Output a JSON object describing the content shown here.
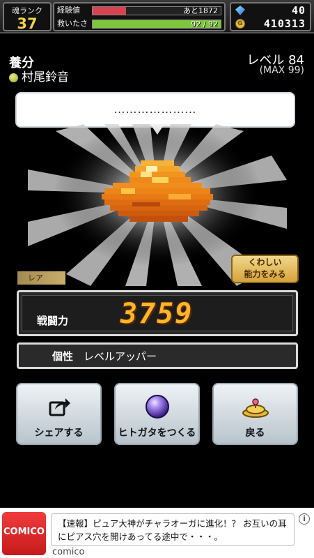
{
  "header": {
    "rank_label": "魂ランク",
    "rank_value": "37",
    "exp_label": "経験値",
    "exp_text": "あと1872",
    "exp_fill": 0.26,
    "saved_label": "救いたさ",
    "saved_text": "92 / 92",
    "saved_fill": 1.0,
    "gems": "40",
    "coins": "410313",
    "coin_icon_text": "G"
  },
  "item": {
    "name": "養分",
    "owner": "村尾鈴音",
    "level": "レベル 84",
    "level_max": "(MAX 99)",
    "speech": "…………………",
    "rarity": "レア",
    "power_label": "戦闘力",
    "power_value": "3759",
    "trait_label": "個性",
    "trait_value": "レベルアッパー"
  },
  "buttons": {
    "details": "くわしい\n能力をみる",
    "share": "シェアする",
    "create": "ヒトガタをつくる",
    "back": "戻る"
  },
  "ad": {
    "logo_text": "COMICO",
    "text": "【速報】ピュア大神がチャラオーガに進化！？ お互いの耳にピアス穴を開けあってる途中で・・・。",
    "brand": "comico",
    "info_icon": "i"
  },
  "colors": {
    "exp_bar": "#d9434f",
    "saved_bar": "#7ec63b",
    "gem_value": "#ffffff",
    "coin_value": "#ffffff"
  }
}
